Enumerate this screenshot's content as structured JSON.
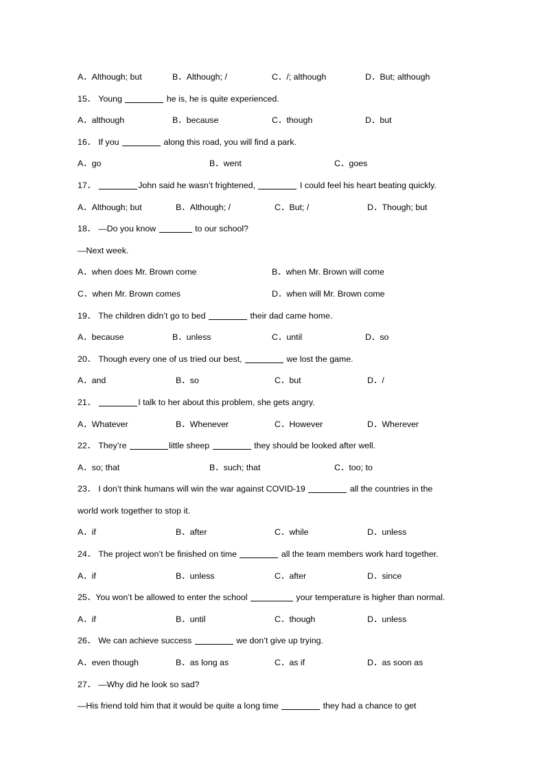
{
  "document": {
    "type": "english-grammar-worksheet",
    "page_background": "#ffffff",
    "text_color": "#000000"
  },
  "items": [
    {
      "id": "opts-14",
      "kind": "options",
      "layout": "four-column",
      "options": [
        "A．Although; but",
        "B．Although; /",
        "C．/; although",
        "D．But; although"
      ]
    },
    {
      "id": "q15",
      "kind": "question",
      "number": "15．",
      "text_before": "Young ",
      "text_after": " he is, he is quite experienced.",
      "blank": "medium"
    },
    {
      "id": "opts-15",
      "kind": "options",
      "layout": "four-column",
      "options": [
        "A．although",
        "B．because",
        "C．though",
        "D．but"
      ]
    },
    {
      "id": "q16",
      "kind": "question",
      "number": "16．",
      "text_before": "If you ",
      "text_after": " along this road, you will find a park.",
      "blank": "medium"
    },
    {
      "id": "opts-16",
      "kind": "options",
      "layout": "three-column",
      "options": [
        "A．go",
        "B．went",
        "C．goes"
      ]
    },
    {
      "id": "q17",
      "kind": "question-double-blank",
      "number": "17．",
      "text_before": " ",
      "text_middle": "John said he wasn’t frightened, ",
      "text_after": " I could feel his heart beating quickly.",
      "blank": "medium"
    },
    {
      "id": "opts-17",
      "kind": "options",
      "layout": "four-column-wide",
      "options": [
        "A．Although; but",
        "B．Although; /",
        "C．But; /",
        "D．Though; but"
      ]
    },
    {
      "id": "q18",
      "kind": "question",
      "number": "18．",
      "text_before": "—Do you know ",
      "text_after": " to our school?",
      "blank": "small"
    },
    {
      "id": "q18-answer",
      "kind": "plain",
      "text": "—Next week."
    },
    {
      "id": "opts-18-row1",
      "kind": "options",
      "layout": "two-column",
      "options": [
        "A．when does Mr. Brown come",
        "B．when Mr. Brown will come"
      ]
    },
    {
      "id": "opts-18-row2",
      "kind": "options",
      "layout": "two-column",
      "options": [
        "C．when Mr. Brown comes",
        "D．when will Mr. Brown come"
      ]
    },
    {
      "id": "q19",
      "kind": "question",
      "number": "19．",
      "text_before": "The children didn’t go to bed ",
      "text_after": " their dad came home.",
      "blank": "medium"
    },
    {
      "id": "opts-19",
      "kind": "options",
      "layout": "four-column",
      "options": [
        "A．because",
        "B．unless",
        "C．until",
        "D．so"
      ]
    },
    {
      "id": "q20",
      "kind": "question",
      "number": "20．",
      "text_before": "Though every one of us tried our best, ",
      "text_after": " we lost the game.",
      "blank": "medium"
    },
    {
      "id": "opts-20",
      "kind": "options",
      "layout": "four-column-wide",
      "options": [
        "A．and",
        "B．so",
        "C．but",
        "D．/"
      ]
    },
    {
      "id": "q21",
      "kind": "question",
      "number": "21．",
      "text_before": " ",
      "text_after": "I talk to her about this problem, she gets angry.",
      "blank": "medium"
    },
    {
      "id": "opts-21",
      "kind": "options",
      "layout": "four-column-wide",
      "options": [
        "A．Whatever",
        "B．Whenever",
        "C．However",
        "D．Wherever"
      ]
    },
    {
      "id": "q22",
      "kind": "question-double-blank",
      "number": "22．",
      "text_before": "They’re ",
      "text_middle": "little sheep ",
      "text_after": " they should be looked after well.",
      "blank": "medium"
    },
    {
      "id": "opts-22",
      "kind": "options",
      "layout": "three-column",
      "options": [
        "A．so; that",
        "B．such; that",
        "C．too; to"
      ]
    },
    {
      "id": "q23",
      "kind": "question",
      "number": "23．",
      "text_before": "I don’t think humans will win the war against COVID-19 ",
      "text_after": " all the countries in the",
      "blank": "medium"
    },
    {
      "id": "q23-cont",
      "kind": "plain",
      "text": "world work together to stop it."
    },
    {
      "id": "opts-23",
      "kind": "options",
      "layout": "four-column-wide",
      "options": [
        "A．if",
        "B．after",
        "C．while",
        "D．unless"
      ]
    },
    {
      "id": "q24",
      "kind": "question",
      "number": "24．",
      "text_before": "The project won’t be finished on time ",
      "text_after": " all the team members work hard together.",
      "blank": "medium"
    },
    {
      "id": "opts-24",
      "kind": "options",
      "layout": "four-column-wide",
      "options": [
        "A．if",
        "B．unless",
        "C．after",
        "D．since"
      ]
    },
    {
      "id": "q25",
      "kind": "question",
      "number": "25．",
      "text_before": "You won’t be allowed to enter the school ",
      "text_after": " your temperature is higher than normal.",
      "blank": "large"
    },
    {
      "id": "opts-25",
      "kind": "options",
      "layout": "four-column-wide",
      "options": [
        "A．if",
        "B．until",
        "C．though",
        "D．unless"
      ]
    },
    {
      "id": "q26",
      "kind": "question",
      "number": "26．",
      "text_before": "We can achieve success ",
      "text_after": " we don’t give up trying.",
      "blank": "medium"
    },
    {
      "id": "opts-26",
      "kind": "options",
      "layout": "four-column-wide",
      "options": [
        "A．even though",
        "B．as long as",
        "C．as if",
        "D．as soon as"
      ]
    },
    {
      "id": "q27",
      "kind": "question-plain",
      "number": "27．",
      "text": "—Why did he look so sad?"
    },
    {
      "id": "q27-answer",
      "kind": "question",
      "number": "",
      "text_before": "—His friend told him that it would be quite a long time ",
      "text_after": " they had a chance to get",
      "blank": "medium"
    }
  ]
}
